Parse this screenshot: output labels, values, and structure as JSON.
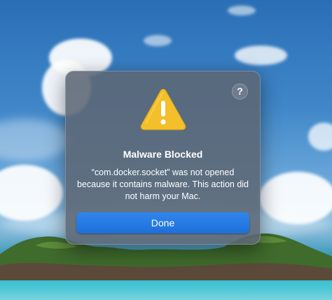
{
  "dialog": {
    "title": "Malware Blocked",
    "message": "“com.docker.socket” was not opened because it contains malware. This action did not harm your Mac.",
    "done_label": "Done",
    "help_label": "?"
  },
  "colors": {
    "accent": "#1f6fdb",
    "warning": "#f5c430"
  },
  "icons": {
    "warning": "warning-triangle-icon",
    "help": "help-icon"
  }
}
